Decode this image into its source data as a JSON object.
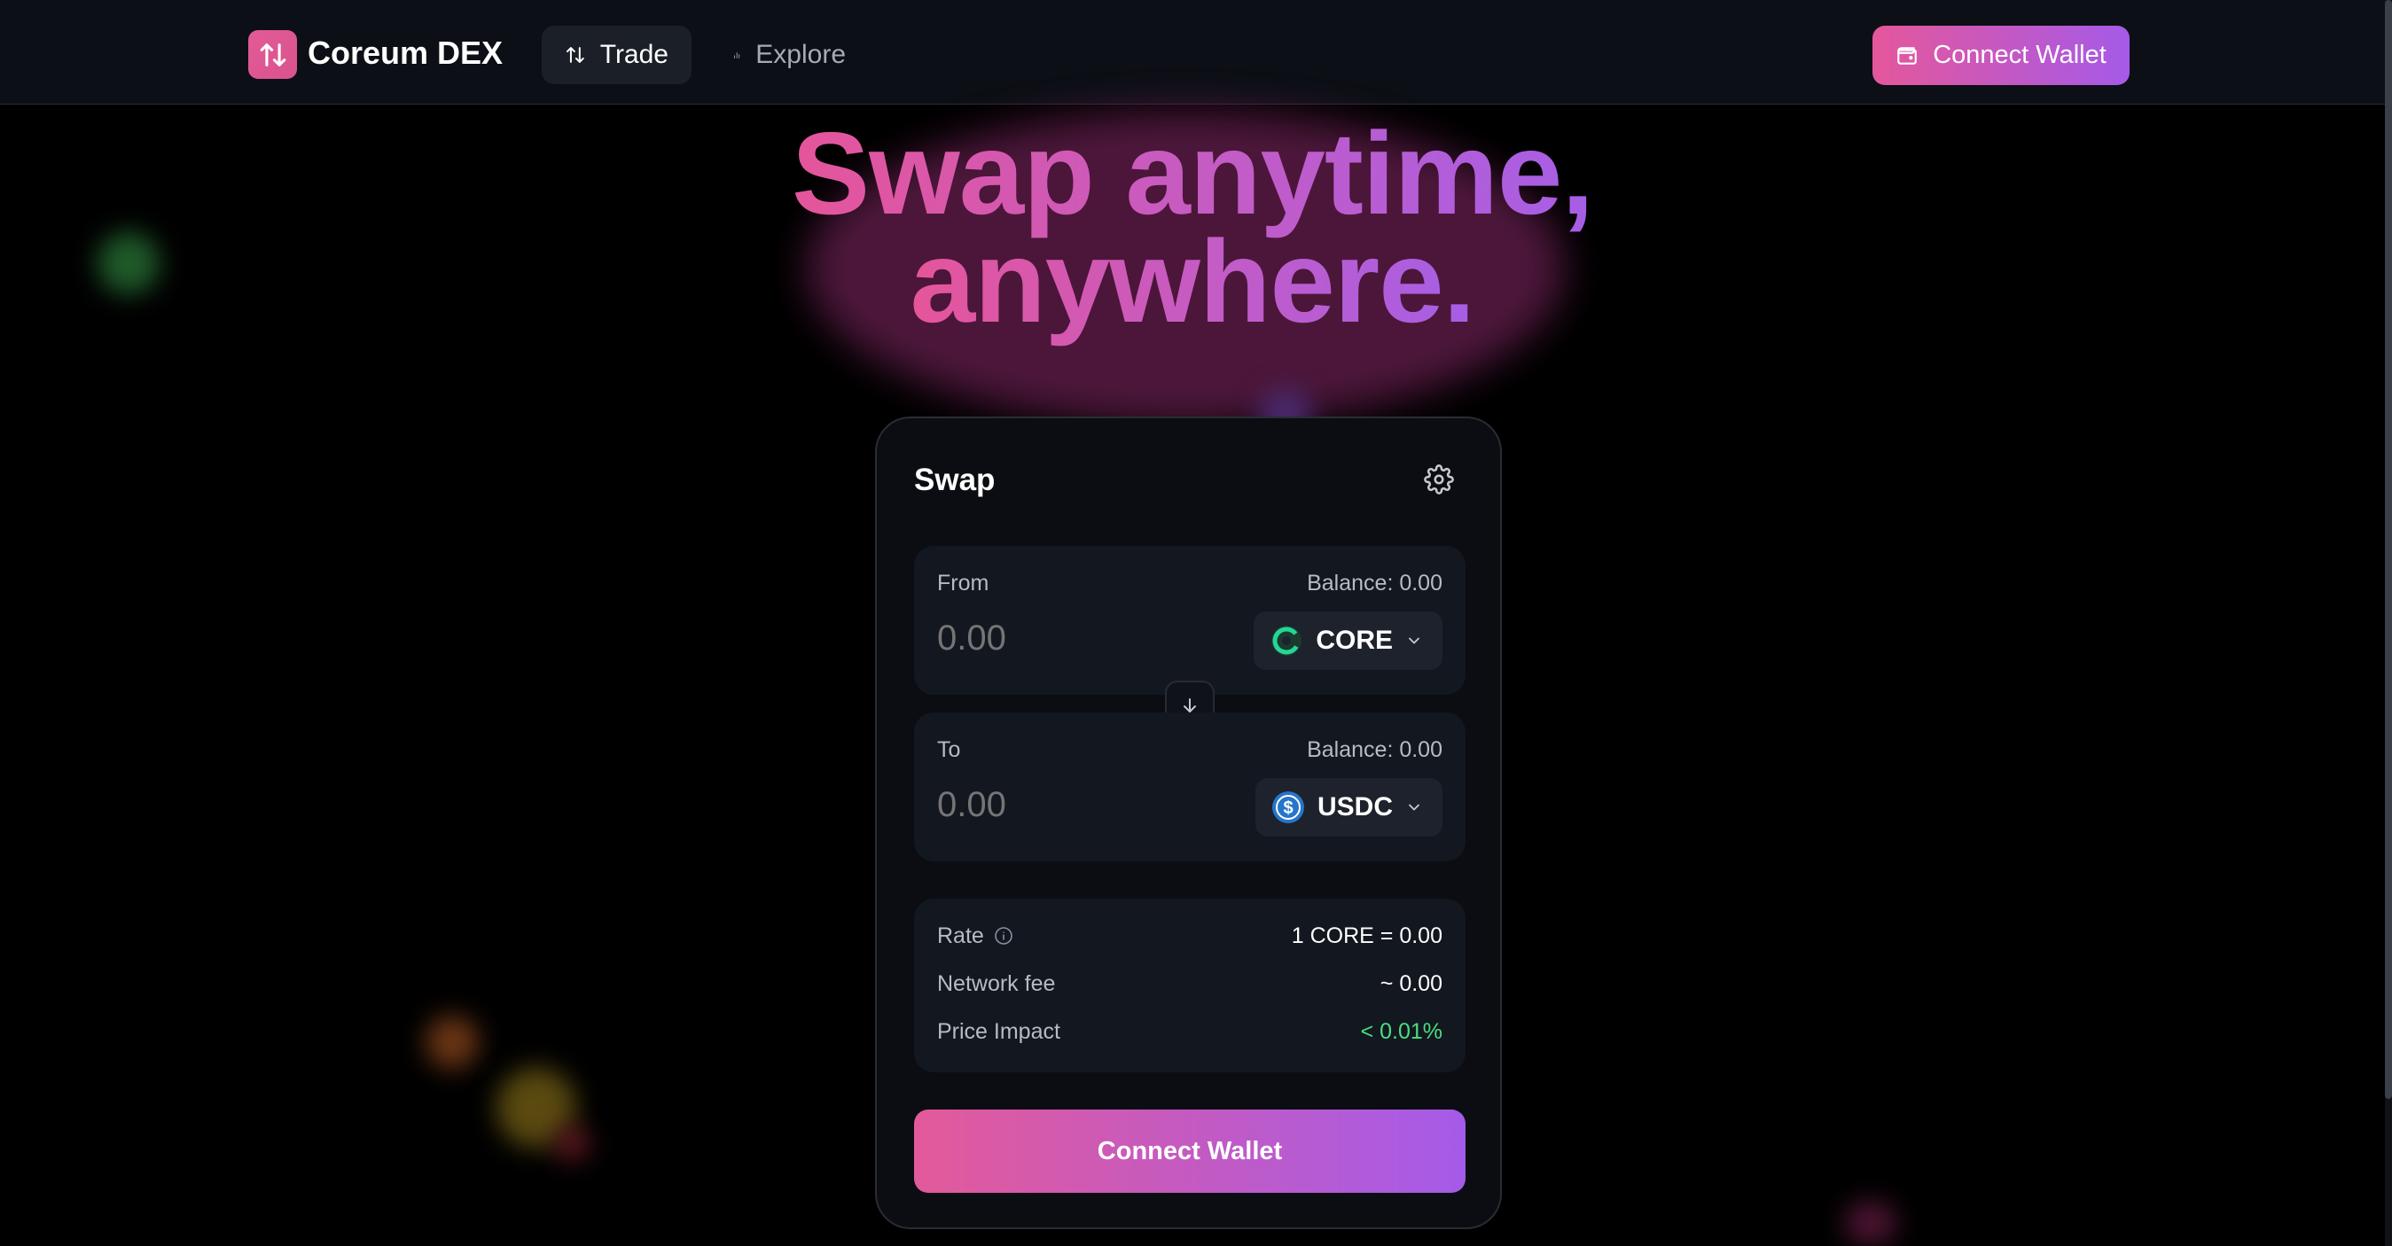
{
  "nav": {
    "brand": "Coreum DEX",
    "items": [
      {
        "label": "Trade",
        "icon": "arrows-up-down-icon",
        "active": true
      },
      {
        "label": "Explore",
        "icon": "bar-chart-icon",
        "active": false
      }
    ],
    "connect_label": "Connect Wallet"
  },
  "hero": {
    "line1": "Swap anytime,",
    "line2": "anywhere."
  },
  "swap": {
    "title": "Swap",
    "from": {
      "label": "From",
      "balance": "Balance: 0.00",
      "placeholder": "0.00",
      "token": "CORE",
      "token_color": "#25d695"
    },
    "to": {
      "label": "To",
      "balance": "Balance: 0.00",
      "placeholder": "0.00",
      "token": "USDC",
      "token_color": "#2775ca"
    },
    "details": {
      "rate_label": "Rate",
      "rate_value": "1 CORE = 0.00",
      "fee_label": "Network fee",
      "fee_value": "~ 0.00",
      "impact_label": "Price Impact",
      "impact_value": "< 0.01%",
      "impact_color": "#4ade80"
    },
    "cta_label": "Connect Wallet"
  },
  "colors": {
    "accent_start": "#e5579b",
    "accent_end": "#a55ae8"
  }
}
